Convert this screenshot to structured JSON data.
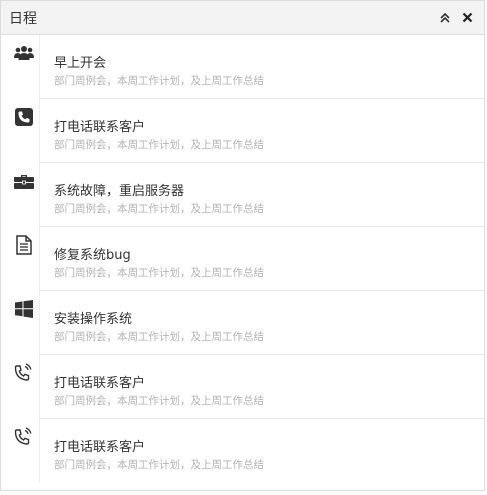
{
  "panel": {
    "title": "日程"
  },
  "header": {
    "collapse_icon": "double-chevron-up-icon",
    "close_icon": "close-icon"
  },
  "items": [
    {
      "icon": "users-icon",
      "title": "早上开会",
      "desc": "部门周例会，本周工作计划，及上周工作总结"
    },
    {
      "icon": "phone-icon",
      "title": "打电话联系客户",
      "desc": "部门周例会，本周工作计划，及上周工作总结"
    },
    {
      "icon": "briefcase-icon",
      "title": "系统故障，重启服务器",
      "desc": "部门周例会，本周工作计划，及上周工作总结"
    },
    {
      "icon": "document-icon",
      "title": "修复系统bug",
      "desc": "部门周例会，本周工作计划，及上周工作总结"
    },
    {
      "icon": "windows-icon",
      "title": "安装操作系统",
      "desc": "部门周例会，本周工作计划，及上周工作总结"
    },
    {
      "icon": "phone-ringing-icon",
      "title": "打电话联系客户",
      "desc": "部门周例会，本周工作计划，及上周工作总结"
    },
    {
      "icon": "phone-ringing-icon",
      "title": "打电话联系客户",
      "desc": "部门周例会，本周工作计划，及上周工作总结"
    }
  ]
}
